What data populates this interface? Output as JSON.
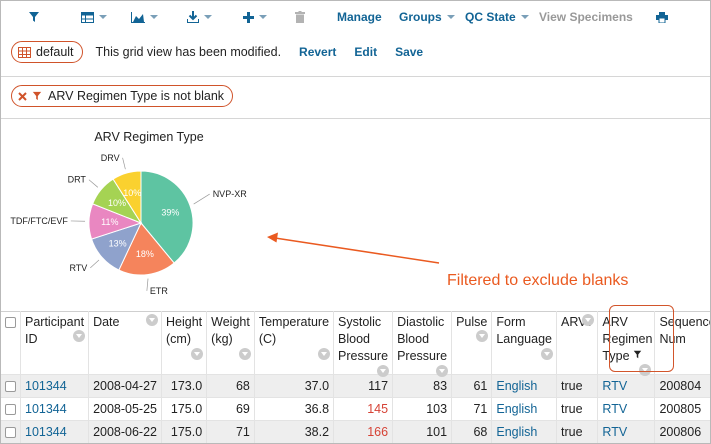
{
  "toolbar": {
    "manage_label": "Manage",
    "groups_label": "Groups",
    "qc_state_label": "QC State",
    "view_specimens_label": "View Specimens"
  },
  "view": {
    "name": "default",
    "message": "This grid view has been modified.",
    "revert_label": "Revert",
    "edit_label": "Edit",
    "save_label": "Save"
  },
  "filter": {
    "text": "ARV Regimen Type is not blank"
  },
  "chart_data": {
    "type": "pie",
    "title": "ARV Regimen Type",
    "slices": [
      {
        "label": "NVP-XR",
        "value": 39,
        "pct_label": "39%",
        "color": "#5ec4a2"
      },
      {
        "label": "ETR",
        "value": 18,
        "pct_label": "18%",
        "color": "#f5845c"
      },
      {
        "label": "RTV",
        "value": 13,
        "pct_label": "13%",
        "color": "#8fa2cc"
      },
      {
        "label": "TDF/FTC/EVF",
        "value": 11,
        "pct_label": "11%",
        "color": "#e987c1"
      },
      {
        "label": "DRT",
        "value": 10,
        "pct_label": "10%",
        "color": "#a5d353"
      },
      {
        "label": "DRV",
        "value": 9,
        "pct_label": "10%",
        "color": "#fad12f"
      }
    ]
  },
  "annotation": {
    "text": "Filtered to exclude blanks",
    "color": "#ea5a20"
  },
  "grid": {
    "columns": [
      {
        "label": "Participant ID"
      },
      {
        "label": "Date"
      },
      {
        "label": "Height (cm)"
      },
      {
        "label": "Weight (kg)"
      },
      {
        "label": "Temperature (C)"
      },
      {
        "label": "Systolic Blood Pressure"
      },
      {
        "label": "Diastolic Blood Pressure"
      },
      {
        "label": "Pulse"
      },
      {
        "label": "Form Language"
      },
      {
        "label": "ARV?"
      },
      {
        "label": "ARV Regimen Type"
      },
      {
        "label": "Sequence Num"
      }
    ],
    "rows": [
      {
        "participant": "101344",
        "date": "2008-04-27",
        "height": "173.0",
        "weight": "68",
        "temp": "37.0",
        "systolic": "117",
        "diastolic": "83",
        "pulse": "61",
        "lang": "English",
        "arv": "true",
        "regimen": "RTV",
        "seq": "200804"
      },
      {
        "participant": "101344",
        "date": "2008-05-25",
        "height": "175.0",
        "weight": "69",
        "temp": "36.8",
        "systolic": "145",
        "diastolic": "103",
        "pulse": "71",
        "lang": "English",
        "arv": "true",
        "regimen": "RTV",
        "seq": "200805"
      },
      {
        "participant": "101344",
        "date": "2008-06-22",
        "height": "175.0",
        "weight": "71",
        "temp": "38.2",
        "systolic": "166",
        "diastolic": "101",
        "pulse": "68",
        "lang": "English",
        "arv": "true",
        "regimen": "RTV",
        "seq": "200806"
      }
    ]
  }
}
